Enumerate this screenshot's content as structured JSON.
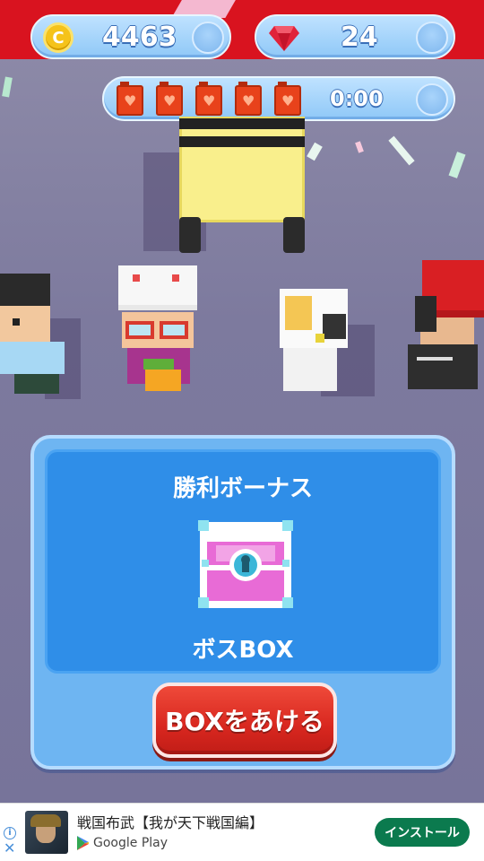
{
  "hud": {
    "coins": "4463",
    "gems": "24",
    "fuel_cans": 5,
    "fuel_timer": "0:00",
    "coin_symbol": "C"
  },
  "modal": {
    "title": "勝利ボーナス",
    "reward_name": "ボスBOX",
    "open_button_label": "BOXをあける",
    "accent_color": "#2f8ee8",
    "button_color": "#d8271f"
  },
  "ad": {
    "title": "戦国布武【我が天下戦国編】",
    "store": "Google Play",
    "install_label": "インストール"
  }
}
